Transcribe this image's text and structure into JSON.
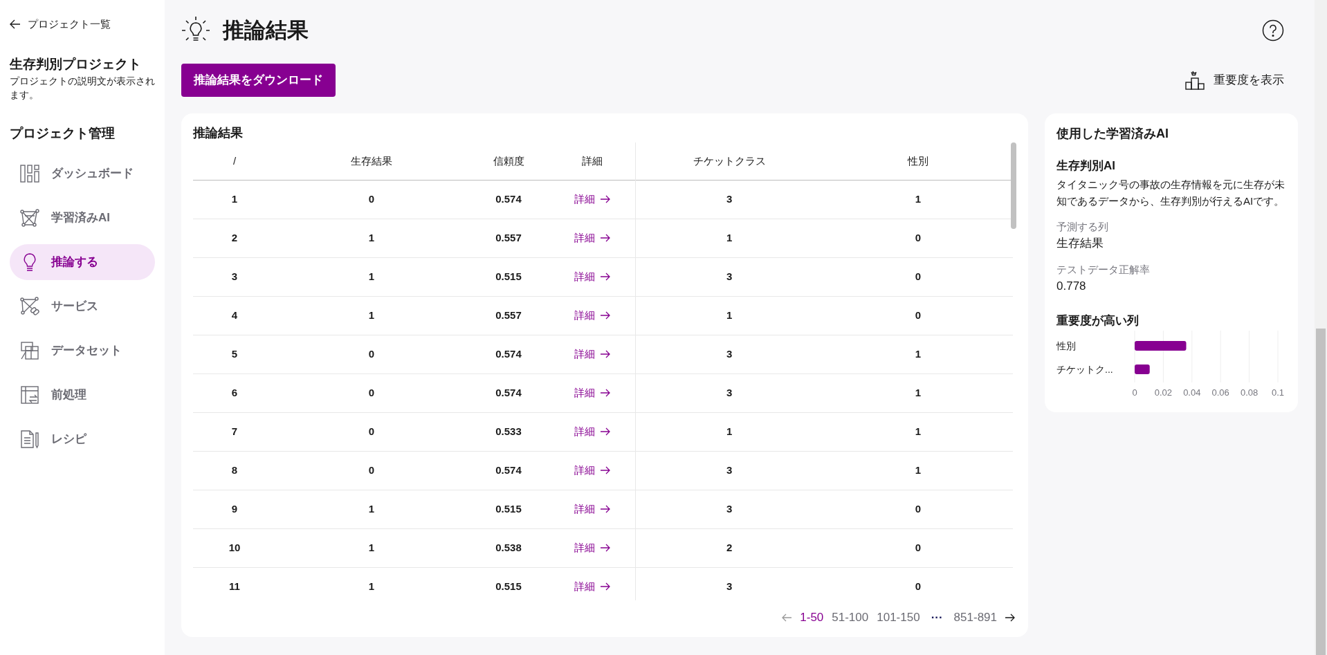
{
  "sidebar": {
    "back_link": "プロジェクト一覧",
    "project_title": "生存判別プロジェクト",
    "project_description": "プロジェクトの説明文が表示されます。",
    "section_title": "プロジェクト管理",
    "items": [
      {
        "kind": "dashboard",
        "label": "ダッシュボード",
        "selected": false
      },
      {
        "kind": "model",
        "label": "学習済みAI",
        "selected": false
      },
      {
        "kind": "inference",
        "label": "推論する",
        "selected": true
      },
      {
        "kind": "service",
        "label": "サービス",
        "selected": false
      },
      {
        "kind": "dataset",
        "label": "データセット",
        "selected": false
      },
      {
        "kind": "preprocess",
        "label": "前処理",
        "selected": false
      },
      {
        "kind": "recipe",
        "label": "レシピ",
        "selected": false
      }
    ]
  },
  "header": {
    "title": "推論結果",
    "download_button": "推論結果をダウンロード",
    "importance_button": "重要度を表示"
  },
  "table": {
    "title": "推論結果",
    "columns": [
      "/",
      "生存結果",
      "信頼度",
      "詳細",
      "チケットクラス",
      "性別"
    ],
    "rows": [
      {
        "index": "1",
        "survival": "0",
        "confidence": "0.574",
        "detail": "詳細",
        "ticket_class": "3",
        "sex": "1"
      },
      {
        "index": "2",
        "survival": "1",
        "confidence": "0.557",
        "detail": "詳細",
        "ticket_class": "1",
        "sex": "0"
      },
      {
        "index": "3",
        "survival": "1",
        "confidence": "0.515",
        "detail": "詳細",
        "ticket_class": "3",
        "sex": "0"
      },
      {
        "index": "4",
        "survival": "1",
        "confidence": "0.557",
        "detail": "詳細",
        "ticket_class": "1",
        "sex": "0"
      },
      {
        "index": "5",
        "survival": "0",
        "confidence": "0.574",
        "detail": "詳細",
        "ticket_class": "3",
        "sex": "1"
      },
      {
        "index": "6",
        "survival": "0",
        "confidence": "0.574",
        "detail": "詳細",
        "ticket_class": "3",
        "sex": "1"
      },
      {
        "index": "7",
        "survival": "0",
        "confidence": "0.533",
        "detail": "詳細",
        "ticket_class": "1",
        "sex": "1"
      },
      {
        "index": "8",
        "survival": "0",
        "confidence": "0.574",
        "detail": "詳細",
        "ticket_class": "3",
        "sex": "1"
      },
      {
        "index": "9",
        "survival": "1",
        "confidence": "0.515",
        "detail": "詳細",
        "ticket_class": "3",
        "sex": "0"
      },
      {
        "index": "10",
        "survival": "1",
        "confidence": "0.538",
        "detail": "詳細",
        "ticket_class": "2",
        "sex": "0"
      },
      {
        "index": "11",
        "survival": "1",
        "confidence": "0.515",
        "detail": "詳細",
        "ticket_class": "3",
        "sex": "0"
      }
    ],
    "pagination": {
      "prev_disabled": true,
      "next_disabled": false,
      "ellipsis": "···",
      "pages": [
        {
          "label": "1-50",
          "selected": true
        },
        {
          "label": "51-100",
          "selected": false
        },
        {
          "label": "101-150",
          "selected": false
        },
        {
          "label": "851-891",
          "selected": false
        }
      ]
    }
  },
  "model_panel": {
    "title": "使用した学習済みAI",
    "model_name": "生存判別AI",
    "description": "タイタニック号の事故の生存情報を元に生存が未知であるデータから、生存判別が行えるAIです。",
    "target_label": "予測する列",
    "target_value": "生存結果",
    "accuracy_label": "テストデータ正解率",
    "accuracy_value": "0.778",
    "importance_title": "重要度が高い列",
    "chart_data": {
      "type": "bar",
      "orientation": "horizontal",
      "categories": [
        "性別",
        "チケットク..."
      ],
      "series": [
        {
          "color": "#870091",
          "values": [
            0.036,
            0.0105
          ]
        }
      ],
      "grid": true,
      "xlim": [
        0,
        0.1
      ],
      "xticks": [
        0,
        0.02,
        0.04,
        0.06,
        0.08,
        0.1
      ]
    }
  }
}
